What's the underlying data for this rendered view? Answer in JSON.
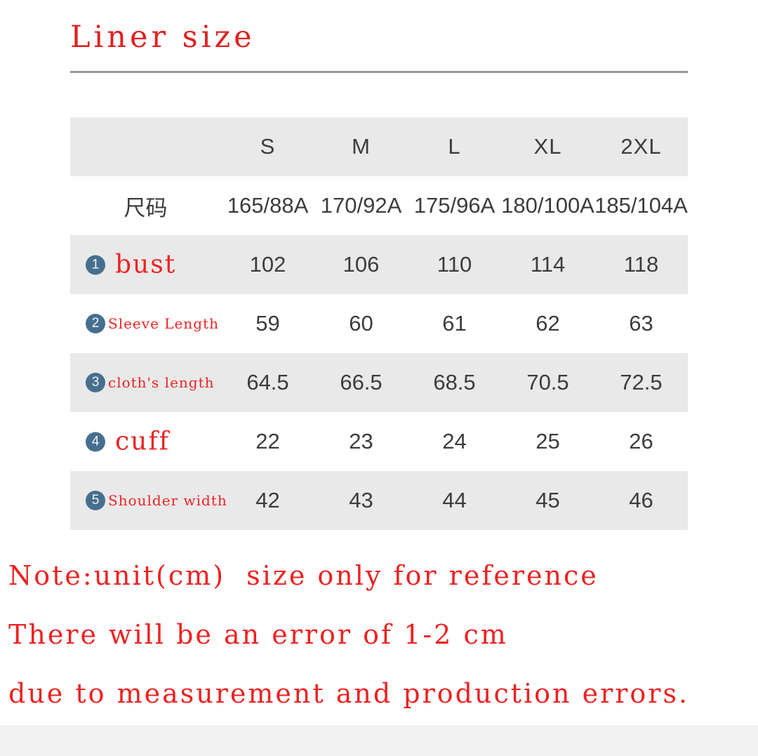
{
  "title": "Liner size",
  "table": {
    "size_header": {
      "label": "",
      "sizes": [
        "S",
        "M",
        "L",
        "XL",
        "2XL"
      ]
    },
    "code_row": {
      "label": "尺码",
      "values": [
        "165/88A",
        "170/92A",
        "175/96A",
        "180/100A",
        "185/104A"
      ]
    },
    "rows": [
      {
        "badge": "1",
        "label": "bust",
        "label_size": "big",
        "values": [
          "102",
          "106",
          "110",
          "114",
          "118"
        ]
      },
      {
        "badge": "2",
        "label": "Sleeve Length",
        "label_size": "small",
        "values": [
          "59",
          "60",
          "61",
          "62",
          "63"
        ]
      },
      {
        "badge": "3",
        "label": "cloth's length",
        "label_size": "small",
        "values": [
          "64.5",
          "66.5",
          "68.5",
          "70.5",
          "72.5"
        ]
      },
      {
        "badge": "4",
        "label": "cuff",
        "label_size": "big",
        "values": [
          "22",
          "23",
          "24",
          "25",
          "26"
        ]
      },
      {
        "badge": "5",
        "label": "Shoulder width",
        "label_size": "small",
        "values": [
          "42",
          "43",
          "44",
          "45",
          "46"
        ]
      }
    ]
  },
  "notes": [
    "Note:unit(cm)  size only for reference",
    "There will be an error of 1-2 cm",
    "due to measurement and production errors."
  ],
  "colors": {
    "accent_red": "#ee2222",
    "badge_blue": "#466f8f",
    "row_shade": "#e9e9e9",
    "rule_gray": "#969696",
    "text_gray": "#3c3c3c"
  }
}
